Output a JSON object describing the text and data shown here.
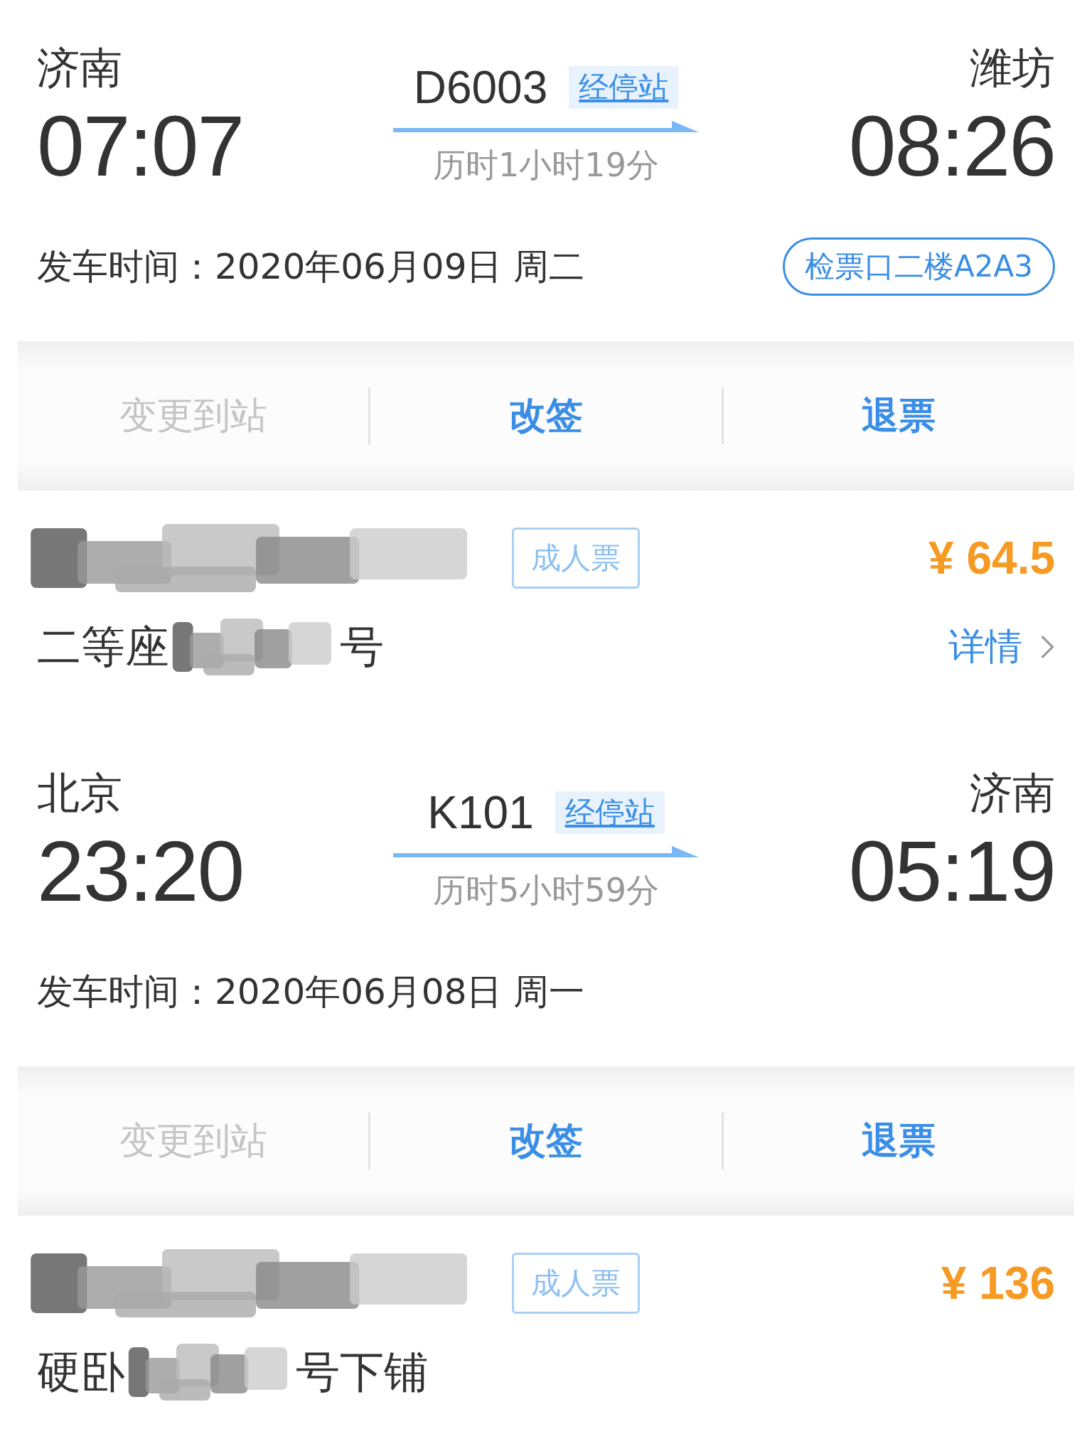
{
  "tickets": [
    {
      "from": {
        "station": "济南",
        "time": "07:07"
      },
      "to": {
        "station": "潍坊",
        "time": "08:26"
      },
      "train": "D6003",
      "stops_link": "经停站",
      "duration": "历时1小时19分",
      "departure": "发车时间：2020年06月09日 周二",
      "gate": "检票口二楼A2A3",
      "actions": [
        {
          "label": "变更到站",
          "disabled": true
        },
        {
          "label": "改签",
          "disabled": false
        },
        {
          "label": "退票",
          "disabled": false
        }
      ],
      "passenger": {
        "redacted": true,
        "ticket_type": "成人票",
        "price": "¥ 64.5",
        "seat_prefix": "二等座",
        "seat_suffix": "号",
        "detail_link": "详情"
      }
    },
    {
      "from": {
        "station": "北京",
        "time": "23:20"
      },
      "to": {
        "station": "济南",
        "time": "05:19"
      },
      "train": "K101",
      "stops_link": "经停站",
      "duration": "历时5小时59分",
      "departure": "发车时间：2020年06月08日 周一",
      "actions": [
        {
          "label": "变更到站",
          "disabled": true
        },
        {
          "label": "改签",
          "disabled": false
        },
        {
          "label": "退票",
          "disabled": false
        }
      ],
      "passenger": {
        "redacted": true,
        "ticket_type": "成人票",
        "price": "¥ 136",
        "seat_prefix": "硬卧",
        "seat_suffix": "号下铺"
      }
    }
  ]
}
